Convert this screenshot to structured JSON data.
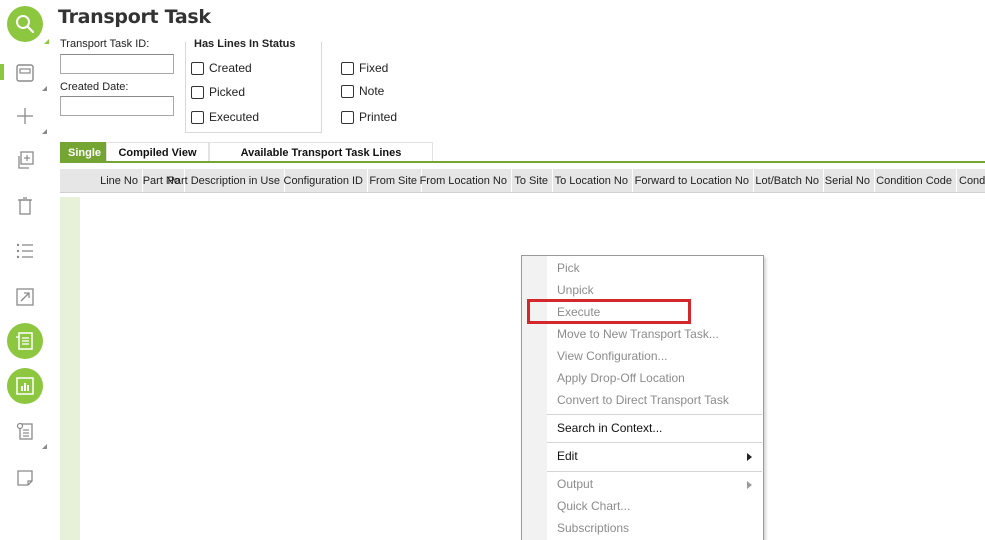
{
  "page": {
    "title": "Transport Task",
    "accent_color": "#8dc63f"
  },
  "toolbar": {
    "buttons": [
      {
        "name": "search-icon",
        "style": "green"
      },
      {
        "name": "save-icon",
        "style": "plain"
      },
      {
        "name": "add-icon",
        "style": "plain"
      },
      {
        "name": "duplicate-icon",
        "style": "plain"
      },
      {
        "name": "delete-icon",
        "style": "plain"
      },
      {
        "name": "list-icon",
        "style": "plain"
      },
      {
        "name": "navigate-icon",
        "style": "plain"
      },
      {
        "name": "details-list-icon",
        "style": "green"
      },
      {
        "name": "chart-icon",
        "style": "green"
      },
      {
        "name": "report-icon",
        "style": "plain"
      },
      {
        "name": "note-icon",
        "style": "plain"
      }
    ]
  },
  "form": {
    "transport_task_id_label": "Transport Task ID:",
    "transport_task_id_value": "",
    "created_date_label": "Created Date:",
    "created_date_value": ""
  },
  "status": {
    "legend": "Has Lines In Status",
    "options": [
      {
        "label": "Created",
        "checked": false
      },
      {
        "label": "Picked",
        "checked": false
      },
      {
        "label": "Executed",
        "checked": false
      },
      {
        "label": "Fixed",
        "checked": false
      },
      {
        "label": "Note",
        "checked": false
      },
      {
        "label": "Printed",
        "checked": false
      }
    ]
  },
  "tabs": [
    {
      "label": "Single",
      "active": true
    },
    {
      "label": "Compiled View",
      "active": false
    },
    {
      "label": "Available Transport Task Lines",
      "active": false
    }
  ],
  "grid": {
    "columns": [
      "Line No",
      "Part No",
      "Part Description in Use",
      "Configuration ID",
      "From Site",
      "From Location No",
      "To Site",
      "To Location No",
      "Forward to Location No",
      "Lot/Batch No",
      "Serial No",
      "Condition Code",
      "Cond"
    ]
  },
  "context_menu": {
    "items": [
      {
        "label": "Pick",
        "enabled": false
      },
      {
        "label": "Unpick",
        "enabled": false
      },
      {
        "label": "Execute",
        "enabled": false,
        "highlighted": true
      },
      {
        "label": "Move to New Transport Task...",
        "enabled": false
      },
      {
        "label": "View Configuration...",
        "enabled": false
      },
      {
        "label": "Apply Drop-Off Location",
        "enabled": false
      },
      {
        "label": "Convert to Direct Transport Task",
        "enabled": false
      },
      {
        "label": "Search in Context...",
        "enabled": true
      },
      {
        "label": "Edit",
        "enabled": true,
        "submenu": true
      },
      {
        "label": "Output",
        "enabled": false,
        "submenu": true
      },
      {
        "label": "Quick Chart...",
        "enabled": false
      },
      {
        "label": "Subscriptions",
        "enabled": false
      }
    ],
    "highlight_color": "#d3272c"
  }
}
